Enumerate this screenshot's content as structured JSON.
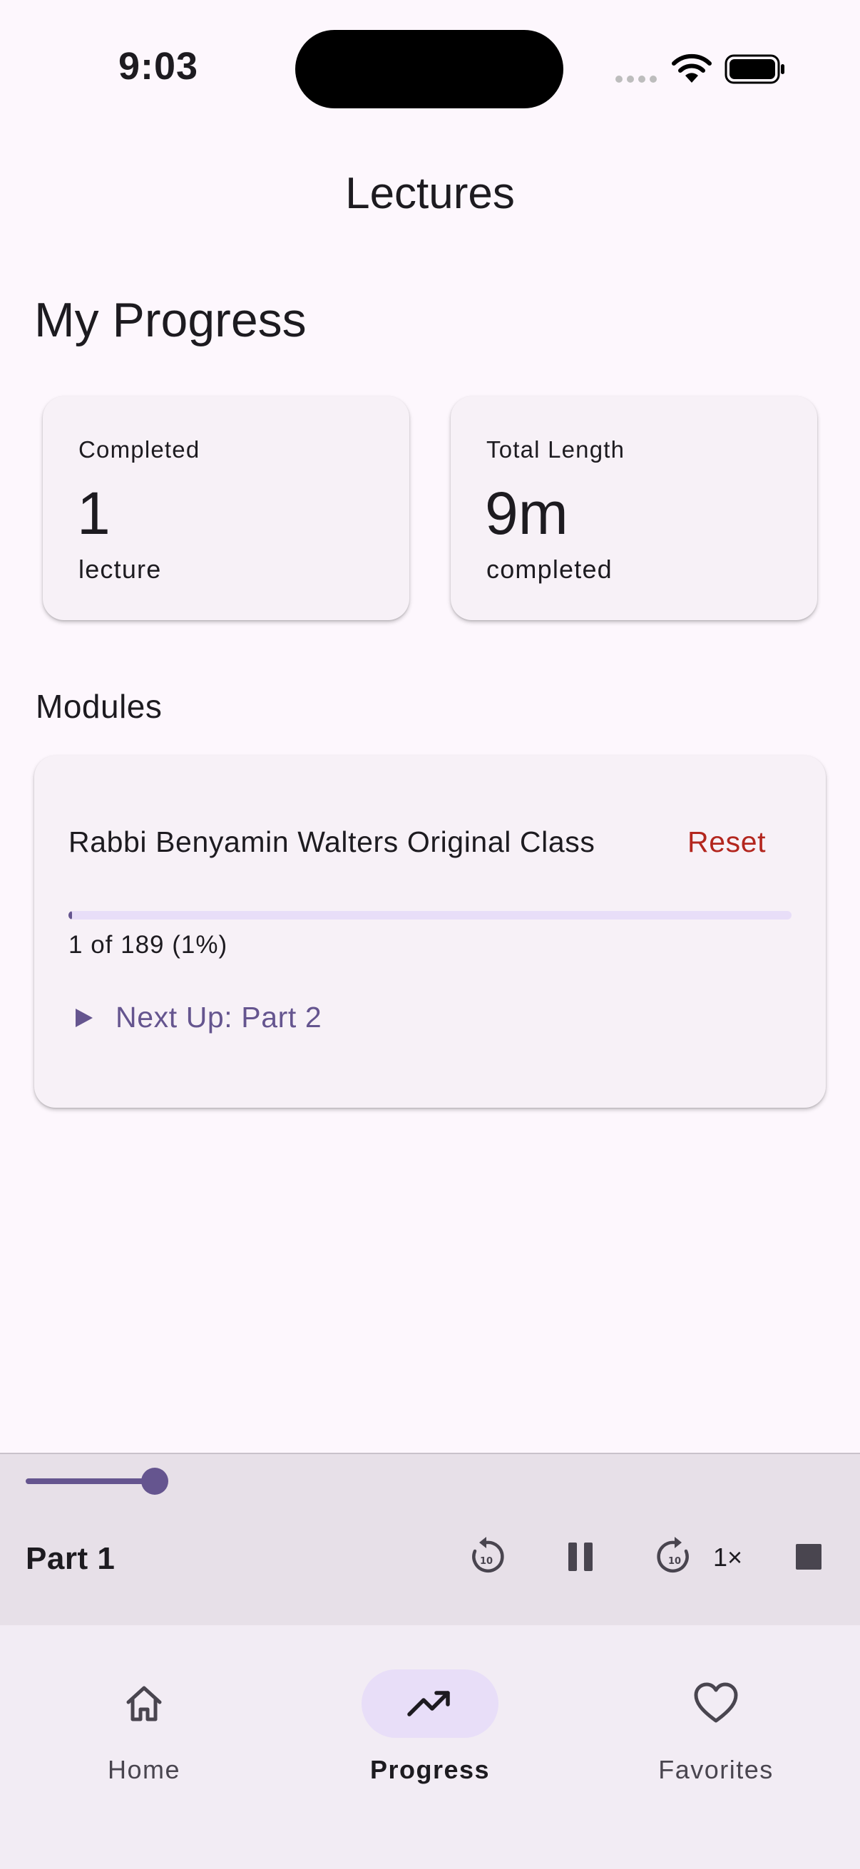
{
  "status_bar": {
    "time": "9:03",
    "icons": [
      "signal-icon",
      "wifi-icon",
      "battery-icon"
    ]
  },
  "app_bar": {
    "title": "Lectures"
  },
  "progress": {
    "title": "My Progress",
    "completed": {
      "label": "Completed",
      "value": "1",
      "unit": "lecture"
    },
    "total_length": {
      "label": "Total Length",
      "value": "9m",
      "unit": "completed"
    }
  },
  "modules": {
    "title": "Modules",
    "items": [
      {
        "name": "Rabbi Benyamin Walters Original Class",
        "reset_label": "Reset",
        "progress_text": "1 of 189 (1%)",
        "progress_fraction": 0.005,
        "next_up_label": "Next Up: Part 2"
      }
    ]
  },
  "player": {
    "title": "Part 1",
    "position_fraction": 0.16,
    "speed_label": "1×",
    "controls": [
      "rewind-10-icon",
      "pause-icon",
      "forward-10-icon",
      "stop-icon"
    ]
  },
  "bottom_nav": {
    "items": [
      {
        "label": "Home",
        "icon": "home-icon",
        "active": false
      },
      {
        "label": "Progress",
        "icon": "trending-up-icon",
        "active": true
      },
      {
        "label": "Favorites",
        "icon": "heart-icon",
        "active": false
      }
    ]
  },
  "colors": {
    "background": "#FDF7FD",
    "card": "#F7F1F7",
    "primary": "#65558F",
    "reset": "#B3261E",
    "player_bg": "#E7E0E8",
    "nav_bg": "#F2ECF4",
    "active_pill": "#E8DEF8"
  }
}
